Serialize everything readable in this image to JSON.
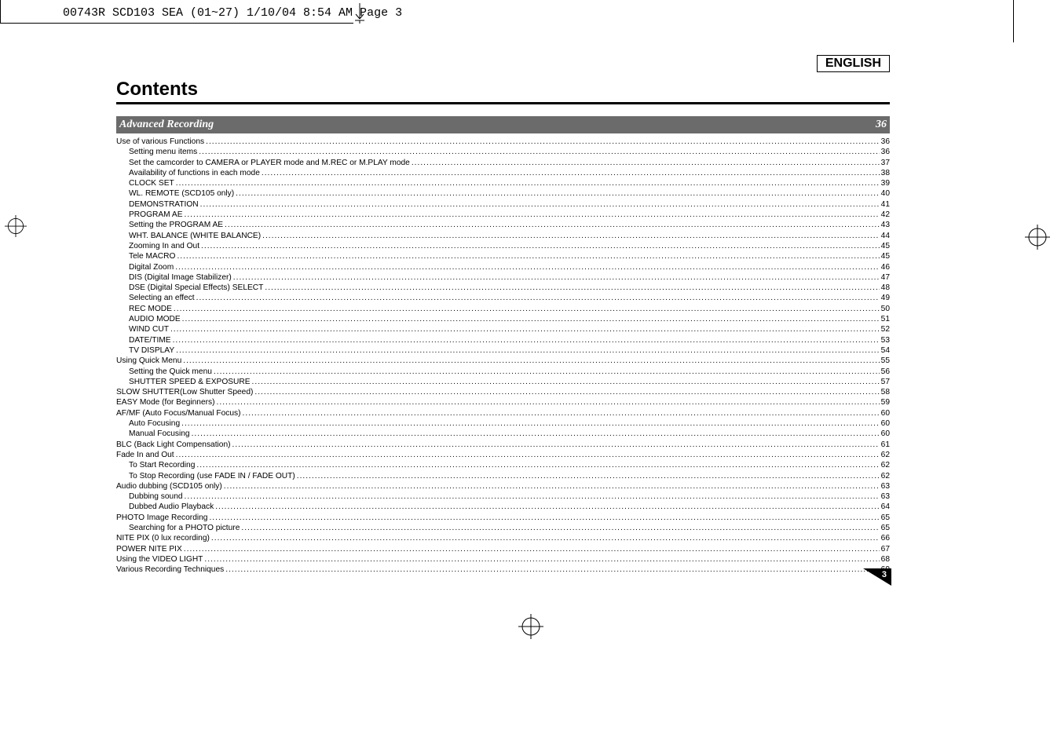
{
  "print_meta": "00743R SCD103 SEA (01~27)  1/10/04 8:54 AM  Page 3",
  "language_label": "ENGLISH",
  "contents_heading": "Contents",
  "section": {
    "title": "Advanced Recording",
    "page": "36"
  },
  "toc": [
    {
      "indent": 0,
      "label": "Use of various Functions",
      "page": "36"
    },
    {
      "indent": 1,
      "label": "Setting menu items",
      "page": "36"
    },
    {
      "indent": 1,
      "label": "Set the camcorder to CAMERA or PLAYER mode and M.REC or M.PLAY mode",
      "page": "37"
    },
    {
      "indent": 1,
      "label": "Availability of functions in each mode",
      "page": "38"
    },
    {
      "indent": 1,
      "label": "CLOCK SET",
      "page": "39"
    },
    {
      "indent": 1,
      "label": "WL. REMOTE (SCD105 only)",
      "page": "40"
    },
    {
      "indent": 1,
      "label": "DEMONSTRATION",
      "page": "41"
    },
    {
      "indent": 1,
      "label": "PROGRAM AE",
      "page": "42"
    },
    {
      "indent": 1,
      "label": "Setting the PROGRAM AE",
      "page": "43"
    },
    {
      "indent": 1,
      "label": "WHT. BALANCE (WHITE BALANCE)",
      "page": "44"
    },
    {
      "indent": 1,
      "label": "Zooming In and Out",
      "page": "45"
    },
    {
      "indent": 1,
      "label": "Tele MACRO",
      "page": "45"
    },
    {
      "indent": 1,
      "label": "Digital Zoom",
      "page": "46"
    },
    {
      "indent": 1,
      "label": "DIS (Digital Image Stabilizer)",
      "page": "47"
    },
    {
      "indent": 1,
      "label": "DSE (Digital Special Effects) SELECT",
      "page": "48"
    },
    {
      "indent": 1,
      "label": "Selecting an effect",
      "page": "49"
    },
    {
      "indent": 1,
      "label": "REC MODE",
      "page": "50"
    },
    {
      "indent": 1,
      "label": "AUDIO MODE",
      "page": "51"
    },
    {
      "indent": 1,
      "label": "WIND CUT",
      "page": "52"
    },
    {
      "indent": 1,
      "label": "DATE/TIME",
      "page": "53"
    },
    {
      "indent": 1,
      "label": "TV DISPLAY",
      "page": "54"
    },
    {
      "indent": 0,
      "label": "Using Quick Menu",
      "page": "55"
    },
    {
      "indent": 1,
      "label": "Setting the Quick menu",
      "page": "56"
    },
    {
      "indent": 1,
      "label": "SHUTTER SPEED & EXPOSURE",
      "page": "57"
    },
    {
      "indent": 0,
      "label": "SLOW SHUTTER(Low Shutter Speed)",
      "page": "58"
    },
    {
      "indent": 0,
      "label": "EASY Mode (for Beginners)",
      "page": "59"
    },
    {
      "indent": 0,
      "label": "AF/MF (Auto Focus/Manual Focus)",
      "page": "60"
    },
    {
      "indent": 1,
      "label": "Auto Focusing",
      "page": "60"
    },
    {
      "indent": 1,
      "label": "Manual Focusing",
      "page": "60"
    },
    {
      "indent": 0,
      "label": "BLC (Back Light Compensation)",
      "page": "61"
    },
    {
      "indent": 0,
      "label": "Fade In and Out",
      "page": "62"
    },
    {
      "indent": 1,
      "label": "To Start Recording",
      "page": "62"
    },
    {
      "indent": 1,
      "label": "To Stop Recording (use FADE IN / FADE OUT)",
      "page": "62"
    },
    {
      "indent": 0,
      "label": "Audio dubbing (SCD105 only)",
      "page": "63"
    },
    {
      "indent": 1,
      "label": "Dubbing sound",
      "page": "63"
    },
    {
      "indent": 1,
      "label": "Dubbed Audio Playback",
      "page": "64"
    },
    {
      "indent": 0,
      "label": "PHOTO Image Recording",
      "page": "65"
    },
    {
      "indent": 1,
      "label": "Searching for a PHOTO picture",
      "page": "65"
    },
    {
      "indent": 0,
      "label": "NITE PIX (0 lux recording)",
      "page": "66"
    },
    {
      "indent": 0,
      "label": "POWER NITE PIX",
      "page": "67"
    },
    {
      "indent": 0,
      "label": "Using the VIDEO LIGHT",
      "page": "68"
    },
    {
      "indent": 0,
      "label": "Various Recording Techniques",
      "page": "69"
    }
  ],
  "page_number": "3"
}
